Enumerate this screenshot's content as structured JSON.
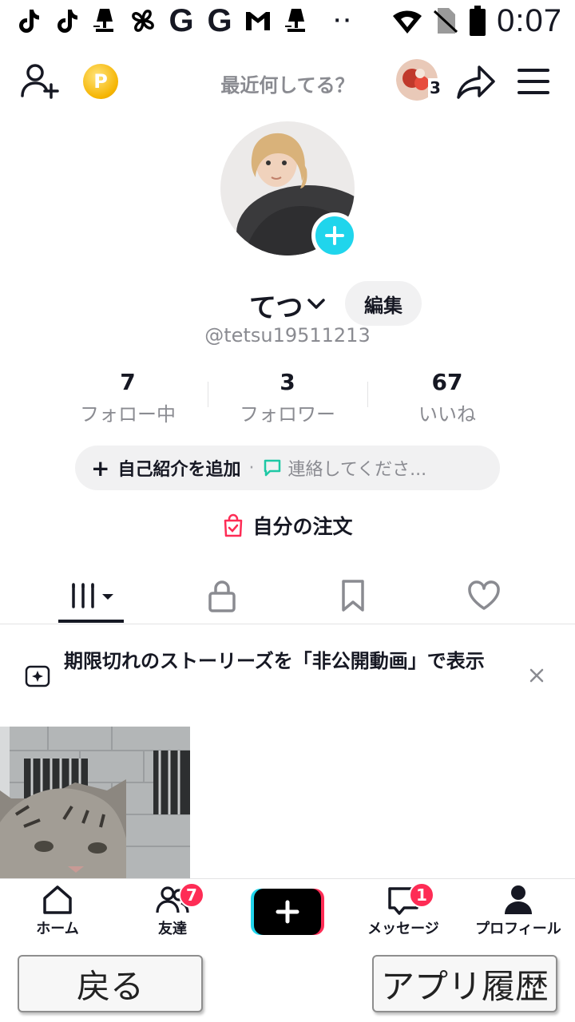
{
  "status_bar": {
    "icons": [
      "tiktok-icon",
      "tiktok-icon",
      "lamp-icon",
      "pinwheel-icon",
      "google-icon",
      "google-icon",
      "gmail-icon",
      "lamp-icon"
    ],
    "google_letter": "G",
    "dots": "··",
    "time": "0:07"
  },
  "top_bar": {
    "coin_letter": "P",
    "status_placeholder": "最近何してる？",
    "stories_count": "3"
  },
  "profile": {
    "name": "てつ",
    "edit_label": "編集",
    "handle": "@tetsu19511213",
    "stats": [
      {
        "value": "7",
        "label": "フォロー中"
      },
      {
        "value": "3",
        "label": "フォロワー"
      },
      {
        "value": "67",
        "label": "いいね"
      }
    ],
    "bio_add_label": "自己紹介を追加",
    "bio_plus": "+",
    "bio_separator": "·",
    "contact_label": "連絡してくださ...",
    "order_label": "自分の注文"
  },
  "notice": {
    "text": "期限切れのストーリーズを「非公開動画」で表示"
  },
  "bottom_nav": {
    "home_label": "ホーム",
    "friends_label": "友達",
    "friends_badge": "7",
    "inbox_label": "メッセージ",
    "inbox_badge": "1",
    "profile_label": "プロフィール"
  },
  "system_buttons": {
    "back_label": "戻る",
    "history_label": "アプリ履歴"
  },
  "colors": {
    "accent_cyan": "#20d5ec",
    "badge_red": "#fe2c55",
    "text_primary": "#161823",
    "text_secondary": "#8a8b91"
  }
}
